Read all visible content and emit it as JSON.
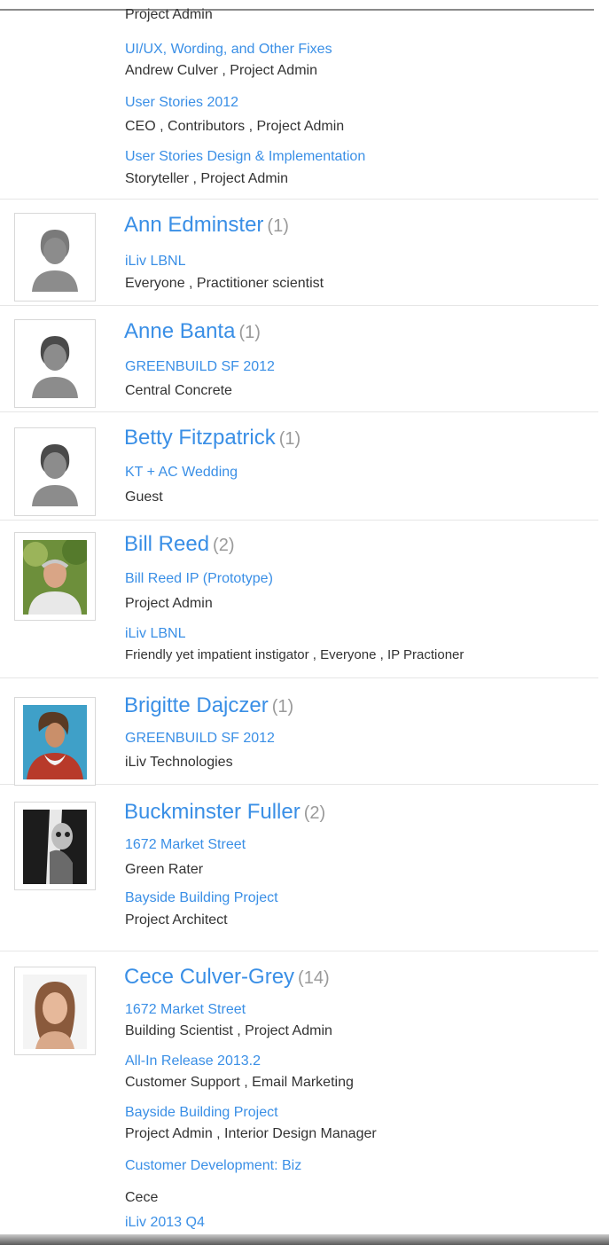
{
  "top_group": {
    "lines": [
      {
        "kind": "role",
        "text": "Project Admin"
      },
      {
        "kind": "project",
        "text": "UI/UX, Wording, and Other Fixes"
      },
      {
        "kind": "role",
        "text": "Andrew Culver , Project Admin"
      },
      {
        "kind": "project",
        "text": "User Stories 2012"
      },
      {
        "kind": "role",
        "text": "CEO , Contributors , Project Admin"
      },
      {
        "kind": "project",
        "text": "User Stories Design & Implementation"
      },
      {
        "kind": "role",
        "text": "Storyteller , Project Admin"
      }
    ]
  },
  "people": [
    {
      "name": "Ann Edminster",
      "count": "(1)",
      "avatar": "placeholder-avatar-icon",
      "memberships": [
        {
          "project": "iLiv LBNL",
          "roles": "Everyone , Practitioner scientist"
        }
      ]
    },
    {
      "name": "Anne Banta",
      "count": "(1)",
      "avatar": "placeholder-avatar-icon",
      "memberships": [
        {
          "project": "GREENBUILD SF 2012",
          "roles": "Central Concrete"
        }
      ]
    },
    {
      "name": "Betty Fitzpatrick",
      "count": "(1)",
      "avatar": "placeholder-avatar-icon",
      "memberships": [
        {
          "project": "KT + AC Wedding",
          "roles": "Guest"
        }
      ]
    },
    {
      "name": "Bill Reed",
      "count": "(2)",
      "avatar": "photo-man-outdoors",
      "memberships": [
        {
          "project": "Bill Reed IP (Prototype)",
          "roles": "Project Admin"
        },
        {
          "project": "iLiv LBNL",
          "roles": "Friendly yet impatient instigator , Everyone , IP Practioner"
        }
      ]
    },
    {
      "name": "Brigitte Dajczer",
      "count": "(1)",
      "avatar": "photo-woman-blue-bg",
      "memberships": [
        {
          "project": "GREENBUILD SF 2012",
          "roles": "iLiv Technologies"
        }
      ]
    },
    {
      "name": "Buckminster Fuller",
      "count": "(2)",
      "avatar": "photo-black-white-portrait",
      "memberships": [
        {
          "project": "1672 Market Street",
          "roles": "Green Rater"
        },
        {
          "project": "Bayside Building Project",
          "roles": "Project Architect"
        }
      ]
    },
    {
      "name": "Cece Culver-Grey",
      "count": "(14)",
      "avatar": "photo-woman-portrait",
      "memberships": [
        {
          "project": "1672 Market Street",
          "roles": "Building Scientist , Project Admin"
        },
        {
          "project": "All-In Release 2013.2",
          "roles": "Customer Support , Email Marketing"
        },
        {
          "project": "Bayside Building Project",
          "roles": "Project Admin , Interior Design Manager"
        },
        {
          "project": "Customer Development: Biz",
          "roles": "Cece"
        },
        {
          "project": "iLiv 2013 Q4",
          "roles": ""
        }
      ]
    }
  ]
}
